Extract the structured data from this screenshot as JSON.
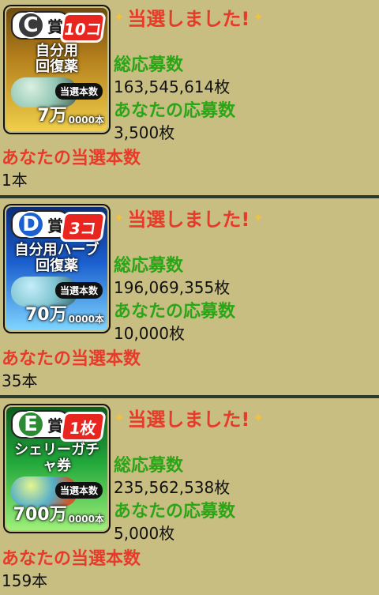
{
  "blocks": [
    {
      "ticket": {
        "rank": "C",
        "rank_suffix": "賞",
        "count": "10コ",
        "title": "自分用\n回復薬",
        "prize_label": "当選本数",
        "prize_value": "7万",
        "prize_tail": "0000本"
      },
      "headline": "当選しました!",
      "total_entries_label": "総応募数",
      "total_entries_value": "163,545,614枚",
      "your_entries_label": "あなたの応募数",
      "your_entries_value": "3,500枚",
      "your_wins_label": "あなたの当選本数",
      "your_wins_value": "1本"
    },
    {
      "ticket": {
        "rank": "D",
        "rank_suffix": "賞",
        "count": "3コ",
        "title": "自分用ハーブ\n回復薬",
        "prize_label": "当選本数",
        "prize_value": "70万",
        "prize_tail": "0000本"
      },
      "headline": "当選しました!",
      "total_entries_label": "総応募数",
      "total_entries_value": "196,069,355枚",
      "your_entries_label": "あなたの応募数",
      "your_entries_value": "10,000枚",
      "your_wins_label": "あなたの当選本数",
      "your_wins_value": "35本"
    },
    {
      "ticket": {
        "rank": "E",
        "rank_suffix": "賞",
        "count": "1枚",
        "title": "シェリーガチャ券",
        "prize_label": "当選本数",
        "prize_value": "700万",
        "prize_tail": "0000本"
      },
      "headline": "当選しました!",
      "total_entries_label": "総応募数",
      "total_entries_value": "235,562,538枚",
      "your_entries_label": "あなたの応募数",
      "your_entries_value": "5,000枚",
      "your_wins_label": "あなたの当選本数",
      "your_wins_value": "159本"
    }
  ],
  "colors": {
    "background": "#c8be82",
    "divider": "#2a3b2c",
    "headline": "#e83a2a",
    "label_green": "#2aa516",
    "label_red": "#e83a2a"
  },
  "icons": {
    "sparkle": "sparkle-icon"
  }
}
